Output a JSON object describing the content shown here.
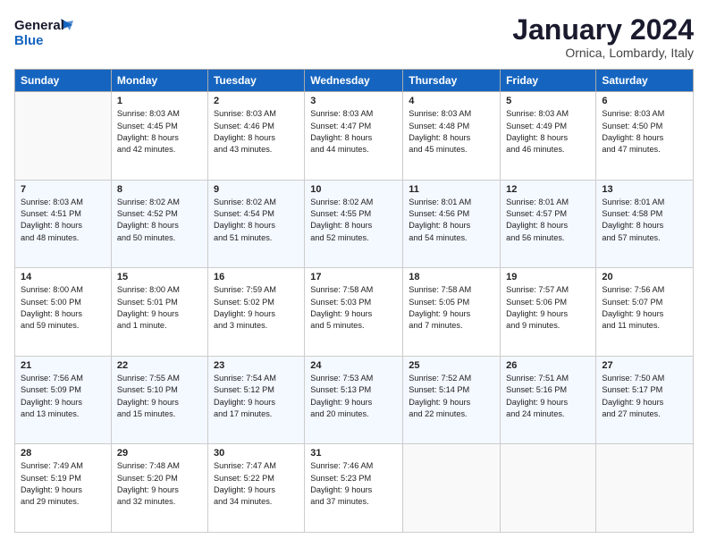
{
  "header": {
    "logo": {
      "general": "General",
      "blue": "Blue"
    },
    "title": "January 2024",
    "location": "Ornica, Lombardy, Italy"
  },
  "weekdays": [
    "Sunday",
    "Monday",
    "Tuesday",
    "Wednesday",
    "Thursday",
    "Friday",
    "Saturday"
  ],
  "weeks": [
    [
      {
        "num": "",
        "info": ""
      },
      {
        "num": "1",
        "info": "Sunrise: 8:03 AM\nSunset: 4:45 PM\nDaylight: 8 hours\nand 42 minutes."
      },
      {
        "num": "2",
        "info": "Sunrise: 8:03 AM\nSunset: 4:46 PM\nDaylight: 8 hours\nand 43 minutes."
      },
      {
        "num": "3",
        "info": "Sunrise: 8:03 AM\nSunset: 4:47 PM\nDaylight: 8 hours\nand 44 minutes."
      },
      {
        "num": "4",
        "info": "Sunrise: 8:03 AM\nSunset: 4:48 PM\nDaylight: 8 hours\nand 45 minutes."
      },
      {
        "num": "5",
        "info": "Sunrise: 8:03 AM\nSunset: 4:49 PM\nDaylight: 8 hours\nand 46 minutes."
      },
      {
        "num": "6",
        "info": "Sunrise: 8:03 AM\nSunset: 4:50 PM\nDaylight: 8 hours\nand 47 minutes."
      }
    ],
    [
      {
        "num": "7",
        "info": "Sunrise: 8:03 AM\nSunset: 4:51 PM\nDaylight: 8 hours\nand 48 minutes."
      },
      {
        "num": "8",
        "info": "Sunrise: 8:02 AM\nSunset: 4:52 PM\nDaylight: 8 hours\nand 50 minutes."
      },
      {
        "num": "9",
        "info": "Sunrise: 8:02 AM\nSunset: 4:54 PM\nDaylight: 8 hours\nand 51 minutes."
      },
      {
        "num": "10",
        "info": "Sunrise: 8:02 AM\nSunset: 4:55 PM\nDaylight: 8 hours\nand 52 minutes."
      },
      {
        "num": "11",
        "info": "Sunrise: 8:01 AM\nSunset: 4:56 PM\nDaylight: 8 hours\nand 54 minutes."
      },
      {
        "num": "12",
        "info": "Sunrise: 8:01 AM\nSunset: 4:57 PM\nDaylight: 8 hours\nand 56 minutes."
      },
      {
        "num": "13",
        "info": "Sunrise: 8:01 AM\nSunset: 4:58 PM\nDaylight: 8 hours\nand 57 minutes."
      }
    ],
    [
      {
        "num": "14",
        "info": "Sunrise: 8:00 AM\nSunset: 5:00 PM\nDaylight: 8 hours\nand 59 minutes."
      },
      {
        "num": "15",
        "info": "Sunrise: 8:00 AM\nSunset: 5:01 PM\nDaylight: 9 hours\nand 1 minute."
      },
      {
        "num": "16",
        "info": "Sunrise: 7:59 AM\nSunset: 5:02 PM\nDaylight: 9 hours\nand 3 minutes."
      },
      {
        "num": "17",
        "info": "Sunrise: 7:58 AM\nSunset: 5:03 PM\nDaylight: 9 hours\nand 5 minutes."
      },
      {
        "num": "18",
        "info": "Sunrise: 7:58 AM\nSunset: 5:05 PM\nDaylight: 9 hours\nand 7 minutes."
      },
      {
        "num": "19",
        "info": "Sunrise: 7:57 AM\nSunset: 5:06 PM\nDaylight: 9 hours\nand 9 minutes."
      },
      {
        "num": "20",
        "info": "Sunrise: 7:56 AM\nSunset: 5:07 PM\nDaylight: 9 hours\nand 11 minutes."
      }
    ],
    [
      {
        "num": "21",
        "info": "Sunrise: 7:56 AM\nSunset: 5:09 PM\nDaylight: 9 hours\nand 13 minutes."
      },
      {
        "num": "22",
        "info": "Sunrise: 7:55 AM\nSunset: 5:10 PM\nDaylight: 9 hours\nand 15 minutes."
      },
      {
        "num": "23",
        "info": "Sunrise: 7:54 AM\nSunset: 5:12 PM\nDaylight: 9 hours\nand 17 minutes."
      },
      {
        "num": "24",
        "info": "Sunrise: 7:53 AM\nSunset: 5:13 PM\nDaylight: 9 hours\nand 20 minutes."
      },
      {
        "num": "25",
        "info": "Sunrise: 7:52 AM\nSunset: 5:14 PM\nDaylight: 9 hours\nand 22 minutes."
      },
      {
        "num": "26",
        "info": "Sunrise: 7:51 AM\nSunset: 5:16 PM\nDaylight: 9 hours\nand 24 minutes."
      },
      {
        "num": "27",
        "info": "Sunrise: 7:50 AM\nSunset: 5:17 PM\nDaylight: 9 hours\nand 27 minutes."
      }
    ],
    [
      {
        "num": "28",
        "info": "Sunrise: 7:49 AM\nSunset: 5:19 PM\nDaylight: 9 hours\nand 29 minutes."
      },
      {
        "num": "29",
        "info": "Sunrise: 7:48 AM\nSunset: 5:20 PM\nDaylight: 9 hours\nand 32 minutes."
      },
      {
        "num": "30",
        "info": "Sunrise: 7:47 AM\nSunset: 5:22 PM\nDaylight: 9 hours\nand 34 minutes."
      },
      {
        "num": "31",
        "info": "Sunrise: 7:46 AM\nSunset: 5:23 PM\nDaylight: 9 hours\nand 37 minutes."
      },
      {
        "num": "",
        "info": ""
      },
      {
        "num": "",
        "info": ""
      },
      {
        "num": "",
        "info": ""
      }
    ]
  ]
}
